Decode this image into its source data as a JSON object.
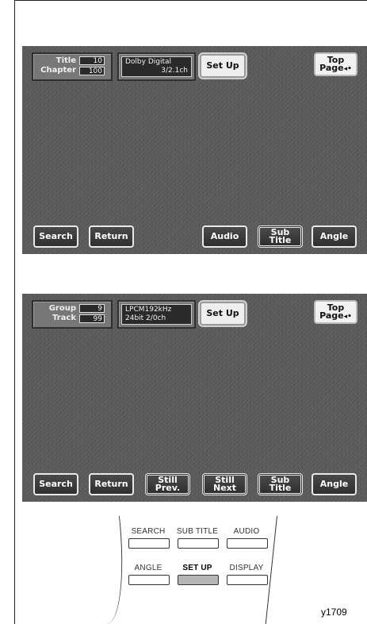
{
  "screen1": {
    "counter": {
      "label1": "Title",
      "value1": "10",
      "label2": "Chapter",
      "value2": "100"
    },
    "format": {
      "line1": "Dolby Digital",
      "line2": "3/2.1ch"
    },
    "setup_label": "Set Up",
    "top_page": {
      "line1": "Top",
      "line2": "Page"
    },
    "buttons": {
      "search": "Search",
      "return": "Return",
      "audio": "Audio",
      "subtitle_line1": "Sub",
      "subtitle_line2": "Title",
      "angle": "Angle"
    }
  },
  "screen2": {
    "counter": {
      "label1": "Group",
      "value1": "9",
      "label2": "Track",
      "value2": "99"
    },
    "format": {
      "line1": "LPCM192kHz",
      "line2": "24bit 2/0ch"
    },
    "setup_label": "Set Up",
    "top_page": {
      "line1": "Top",
      "line2": "Page"
    },
    "buttons": {
      "search": "Search",
      "return": "Return",
      "still_prev_line1": "Still",
      "still_prev_line2": "Prev.",
      "still_next_line1": "Still",
      "still_next_line2": "Next",
      "subtitle_line1": "Sub",
      "subtitle_line2": "Title",
      "angle": "Angle"
    }
  },
  "remote": {
    "row1": [
      "SEARCH",
      "SUB TITLE",
      "AUDIO"
    ],
    "row2": [
      "ANGLE",
      "SET UP",
      "DISPLAY"
    ],
    "highlighted": "SET UP"
  },
  "figure_code": "y1709",
  "icons": {
    "top_page": "return-arrow-icon"
  },
  "colors": {
    "screen_bg": "#5a5a5a",
    "highlight_key": "#b5b5b5"
  }
}
